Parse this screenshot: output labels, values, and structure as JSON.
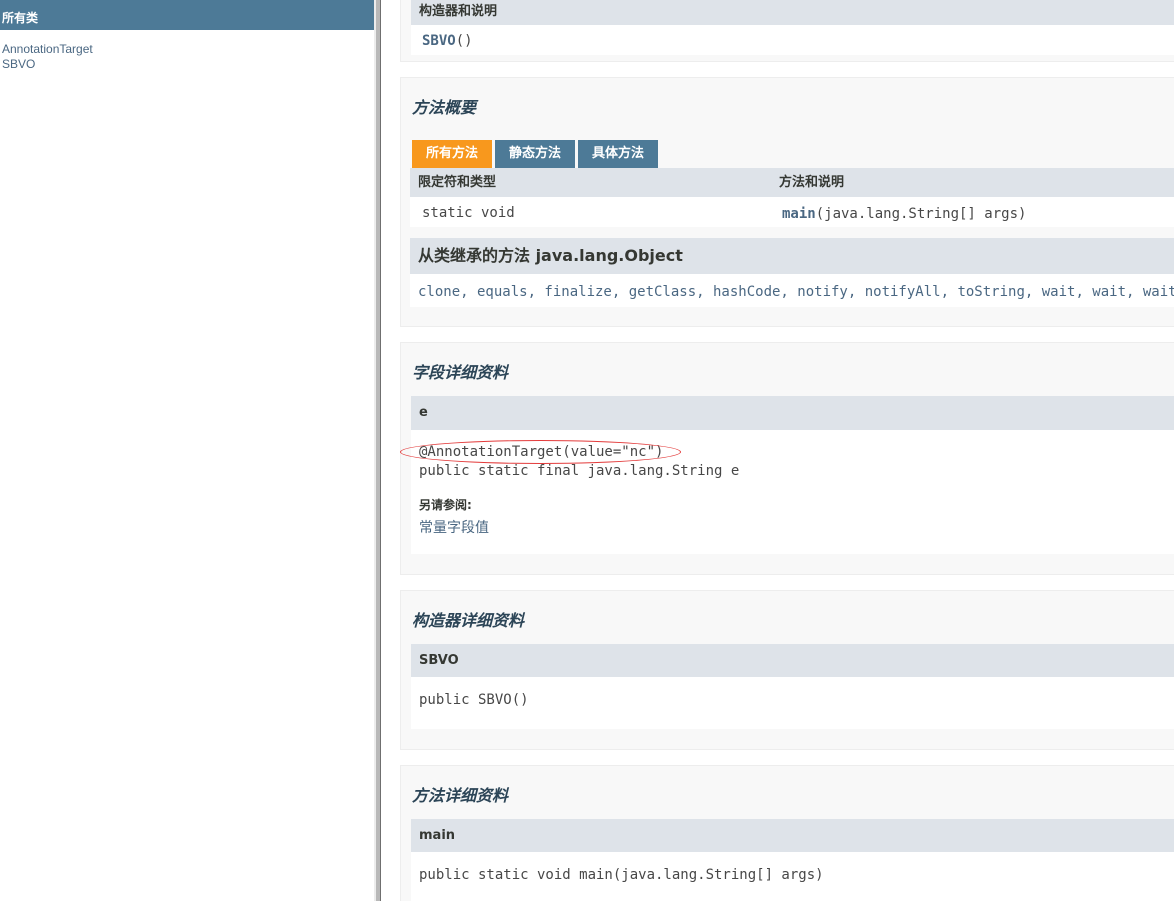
{
  "left": {
    "header": "所有类",
    "classes": [
      "AnnotationTarget",
      "SBVO"
    ]
  },
  "constructor_summary": {
    "header": "构造器和说明",
    "name": "SBVO",
    "parens": "()"
  },
  "method_summary": {
    "title": "方法概要",
    "tabs": [
      "所有方法",
      "静态方法",
      "具体方法"
    ],
    "col_modifier": "限定符和类型",
    "col_method": "方法和说明",
    "row_modifier": "static void",
    "row_method_name": "main",
    "row_method_params": "(java.lang.String[] args)",
    "inherited_title": "从类继承的方法 java.lang.Object",
    "inherited_methods": "clone, equals, finalize, getClass, hashCode, notify, notifyAll, toString, wait, wait, wait"
  },
  "field_detail": {
    "title": "字段详细资料",
    "name": "e",
    "annotation": "@AnnotationTarget(value=\"nc\")",
    "signature": "public static final java.lang.String e",
    "see_also_label": "另请参阅:",
    "see_also_link": "常量字段值"
  },
  "constructor_detail": {
    "title": "构造器详细资料",
    "name": "SBVO",
    "signature": "public SBVO()"
  },
  "method_detail": {
    "title": "方法详细资料",
    "name": "main",
    "signature": "public static void main(java.lang.String[] args)"
  },
  "colors": {
    "header_bg": "#4d7a97",
    "tab_active": "#f8981d",
    "table_head": "#dee3e9",
    "highlight_ellipse": "#e33b3b"
  }
}
